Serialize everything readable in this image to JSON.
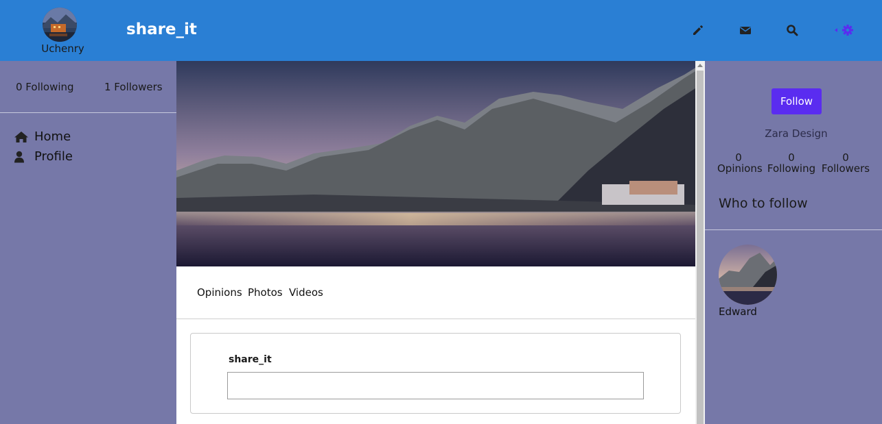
{
  "header": {
    "username": "Uchenry",
    "brand": "share_it",
    "icons": [
      "pencil-icon",
      "envelope-icon",
      "search-icon",
      "gear-icon"
    ]
  },
  "left": {
    "following": "0 Following",
    "followers": "1 Followers",
    "nav": [
      {
        "label": "Home",
        "icon": "home-icon"
      },
      {
        "label": "Profile",
        "icon": "user-icon"
      }
    ]
  },
  "center": {
    "tabs": [
      "Opinions",
      "Photos",
      "Videos"
    ],
    "composer": {
      "label": "share_it",
      "value": ""
    }
  },
  "right": {
    "follow_label": "Follow",
    "profile_name": "Zara Design",
    "stats": [
      {
        "value": "0",
        "label": "Opinions"
      },
      {
        "value": "0",
        "label": "Following"
      },
      {
        "value": "0",
        "label": "Followers"
      }
    ],
    "who_to_follow": "Who to follow",
    "suggestions": [
      {
        "name": "Edward"
      }
    ]
  },
  "colors": {
    "header": "#2a7fd4",
    "sidebar": "#7678a8",
    "accent": "#5a2cf0"
  }
}
